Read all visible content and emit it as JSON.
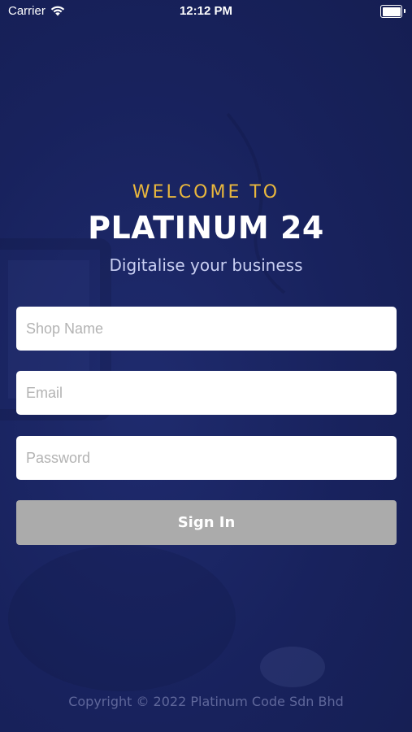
{
  "status_bar": {
    "carrier": "Carrier",
    "time": "12:12 PM",
    "wifi_icon": "wifi-icon",
    "battery_icon": "battery-icon"
  },
  "header": {
    "welcome": "WELCOME TO",
    "brand": "PLATINUM 24",
    "tagline": "Digitalise your business"
  },
  "form": {
    "shop_name_placeholder": "Shop Name",
    "email_placeholder": "Email",
    "password_placeholder": "Password",
    "sign_in_label": "Sign In"
  },
  "footer": {
    "copyright": "Copyright © 2022 Platinum Code Sdn Bhd"
  },
  "colors": {
    "background": "#17215a",
    "welcome_accent": "#e9b73d",
    "button_disabled": "#ababab",
    "input_bg": "#ffffff"
  }
}
